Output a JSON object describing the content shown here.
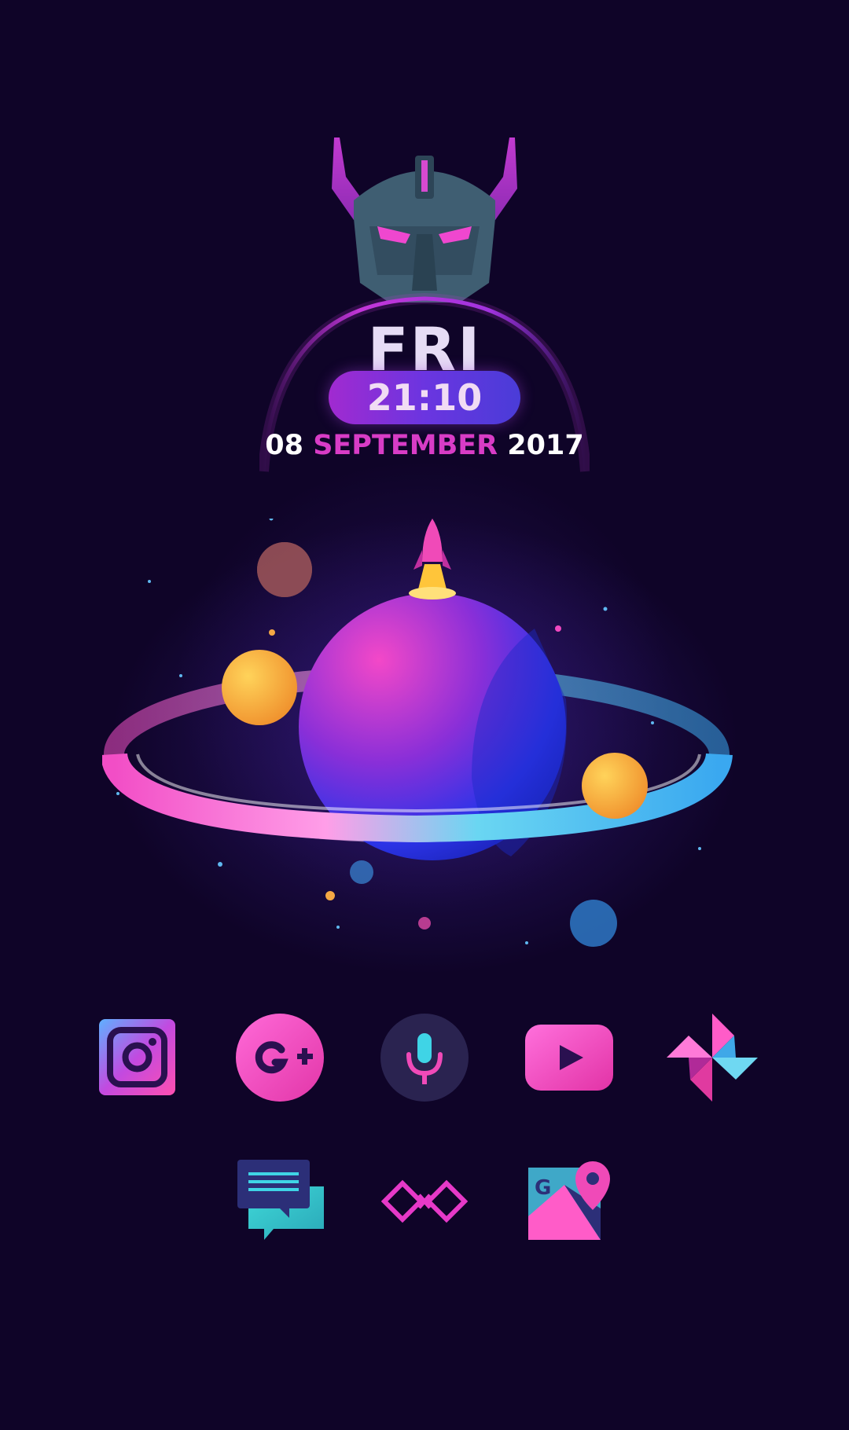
{
  "clock_widget": {
    "day": "FRI",
    "time": "21:10",
    "date_day": "08",
    "date_month": "SEPTEMBER",
    "date_year": "2017"
  },
  "home_icons": {
    "row1": [
      {
        "icon": "instagram-icon"
      },
      {
        "icon": "google-plus-icon"
      },
      {
        "icon": "voice-search-icon"
      },
      {
        "icon": "youtube-icon"
      },
      {
        "icon": "google-photos-icon"
      }
    ],
    "row2": [
      {
        "icon": "messages-icon"
      },
      {
        "icon": "link-icon"
      },
      {
        "icon": "google-maps-icon"
      }
    ]
  },
  "colors": {
    "background": "#0f0428",
    "accent_pink": "#f04ab8",
    "accent_purple": "#6b35e0",
    "month_color": "#d83cc6",
    "cyan": "#3fd4e6"
  }
}
